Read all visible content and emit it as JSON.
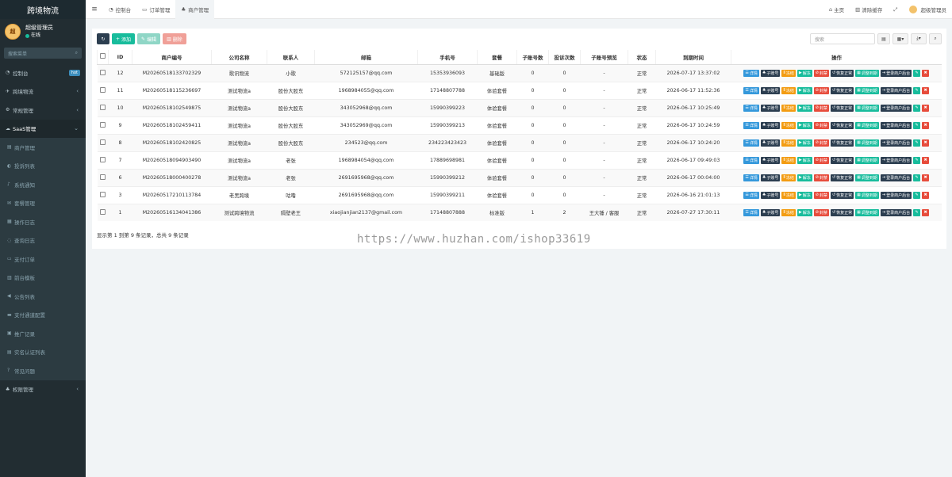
{
  "app": {
    "brand": "跨境物流"
  },
  "user": {
    "name": "超级管理员",
    "status": "在线",
    "avatar_text": "超"
  },
  "sidebar": {
    "search_placeholder": "搜索菜单",
    "items": [
      {
        "icon": "dashboard-icon",
        "glyph": "◔",
        "label": "控制台",
        "badge": "hot",
        "chevron": ""
      },
      {
        "icon": "logistics-icon",
        "glyph": "✈",
        "label": "跨境物流",
        "badge": "",
        "chevron": "‹"
      },
      {
        "icon": "settings-icon",
        "glyph": "⚙",
        "label": "常规管理",
        "badge": "",
        "chevron": "‹"
      },
      {
        "icon": "cloud-icon",
        "glyph": "☁",
        "label": "SaaS管理",
        "badge": "",
        "chevron": "⌄"
      },
      {
        "icon": "merchant-icon",
        "glyph": "▤",
        "label": "商户管理",
        "badge": "",
        "chevron": ""
      },
      {
        "icon": "complaint-icon",
        "glyph": "◐",
        "label": "投诉列表",
        "badge": "",
        "chevron": ""
      },
      {
        "icon": "notice-icon",
        "glyph": "♪",
        "label": "系统通知",
        "badge": "",
        "chevron": ""
      },
      {
        "icon": "package-icon",
        "glyph": "✉",
        "label": "套餐管理",
        "badge": "",
        "chevron": ""
      },
      {
        "icon": "log-icon",
        "glyph": "▦",
        "label": "操作日志",
        "badge": "",
        "chevron": ""
      },
      {
        "icon": "query-icon",
        "glyph": "◌",
        "label": "查询日志",
        "badge": "",
        "chevron": ""
      },
      {
        "icon": "order-icon",
        "glyph": "▭",
        "label": "支付订单",
        "badge": "",
        "chevron": ""
      },
      {
        "icon": "template-icon",
        "glyph": "▥",
        "label": "前台模板",
        "badge": "",
        "chevron": ""
      },
      {
        "icon": "announce-icon",
        "glyph": "◀",
        "label": "公告列表",
        "badge": "",
        "chevron": ""
      },
      {
        "icon": "payment-icon",
        "glyph": "▬",
        "label": "支付通道配置",
        "badge": "",
        "chevron": ""
      },
      {
        "icon": "promo-icon",
        "glyph": "▣",
        "label": "推广记录",
        "badge": "",
        "chevron": ""
      },
      {
        "icon": "auth-icon",
        "glyph": "▤",
        "label": "实名认证列表",
        "badge": "",
        "chevron": ""
      },
      {
        "icon": "faq-icon",
        "glyph": "?",
        "label": "常见问题",
        "badge": "",
        "chevron": ""
      },
      {
        "icon": "permission-icon",
        "glyph": "♣",
        "label": "权限管理",
        "badge": "",
        "chevron": "‹"
      }
    ]
  },
  "topbar": {
    "tabs": [
      {
        "icon": "dashboard-icon",
        "glyph": "◔",
        "label": "控制台"
      },
      {
        "icon": "order-icon",
        "glyph": "▭",
        "label": "订单管理"
      },
      {
        "icon": "merchant-icon",
        "glyph": "♣",
        "label": "商户管理"
      }
    ],
    "home": "主页",
    "clear_cache": "清除缓存",
    "admin": "超级管理员"
  },
  "toolbar": {
    "add": "添加",
    "edit": "编辑",
    "delete": "删除",
    "search_placeholder": "搜索"
  },
  "table": {
    "headers": [
      "ID",
      "商户编号",
      "公司名称",
      "联系人",
      "邮箱",
      "手机号",
      "套餐",
      "子账号数",
      "投诉次数",
      "子账号预览",
      "状态",
      "到期时间",
      "操作"
    ],
    "rows": [
      [
        "12",
        "M20260518133702329",
        "歌讯物流",
        "小歌",
        "572125157@qq.com",
        "15353936093",
        "基础版",
        "0",
        "0",
        "-",
        "正常",
        "2026-07-17 13:37:02"
      ],
      [
        "11",
        "M20260518115236697",
        "测试物流a",
        "股份大股东",
        "1968984055@qq.com",
        "17148807788",
        "体验套餐",
        "0",
        "0",
        "-",
        "正常",
        "2026-06-17 11:52:36"
      ],
      [
        "10",
        "M20260518102549875",
        "测试物流a",
        "股份大股东",
        "343052968@qq.com",
        "15990399223",
        "体验套餐",
        "0",
        "0",
        "-",
        "正常",
        "2026-06-17 10:25:49"
      ],
      [
        "9",
        "M20260518102459411",
        "测试物流a",
        "股份大股东",
        "343052969@qq.com",
        "15990399213",
        "体验套餐",
        "0",
        "0",
        "-",
        "正常",
        "2026-06-17 10:24:59"
      ],
      [
        "8",
        "M20260518102420825",
        "测试物流a",
        "股份大股东",
        "234523@qq.com",
        "234223423423",
        "体验套餐",
        "0",
        "0",
        "-",
        "正常",
        "2026-06-17 10:24:20"
      ],
      [
        "7",
        "M20260518094903490",
        "测试物流a",
        "老张",
        "1968984054@qq.com",
        "17889698981",
        "体验套餐",
        "0",
        "0",
        "-",
        "正常",
        "2026-06-17 09:49:03"
      ],
      [
        "6",
        "M20260518000400278",
        "测试物流a",
        "老张",
        "2691695968@qq.com",
        "15990399212",
        "体验套餐",
        "0",
        "0",
        "-",
        "正常",
        "2026-06-17 00:04:00"
      ],
      [
        "3",
        "M20260517210113784",
        "老黑跨境",
        "咕噜",
        "2691695968@qq.com",
        "15990399211",
        "体验套餐",
        "0",
        "0",
        "-",
        "正常",
        "2026-06-16 21:01:13"
      ],
      [
        "1",
        "M20260516134041386",
        "测试跨境物流",
        "隔壁老王",
        "xiaojianjian2137@gmail.com",
        "17148807888",
        "标准版",
        "1",
        "2",
        "王大锤 / 客服",
        "正常",
        "2026-07-27 17:30:11"
      ]
    ],
    "actions": [
      {
        "label": "详情",
        "color": "blue",
        "glyph": "☰",
        "name": "detail-button"
      },
      {
        "label": "子账号",
        "color": "navy",
        "glyph": "♣",
        "name": "sub-account-button"
      },
      {
        "label": "冻结",
        "color": "orange",
        "glyph": "Ⅱ",
        "name": "freeze-button"
      },
      {
        "label": "解冻",
        "color": "green",
        "glyph": "▶",
        "name": "unfreeze-button"
      },
      {
        "label": "封禁",
        "color": "red",
        "glyph": "⊘",
        "name": "ban-button"
      },
      {
        "label": "恢复正常",
        "color": "navy",
        "glyph": "↺",
        "name": "restore-button"
      },
      {
        "label": "调整到期",
        "color": "green",
        "glyph": "▦",
        "name": "adjust-expiry-button"
      },
      {
        "label": "登录商户后台",
        "color": "navy",
        "glyph": "⇥",
        "name": "login-merchant-button"
      },
      {
        "label": "",
        "color": "green",
        "glyph": "✎",
        "name": "edit-row-button"
      },
      {
        "label": "",
        "color": "red",
        "glyph": "✖",
        "name": "delete-row-button"
      }
    ]
  },
  "pagination": {
    "summary": "显示第 1 到第 9 条记录，总共 9 条记录"
  },
  "watermark": "https://www.huzhan.com/ishop33619"
}
